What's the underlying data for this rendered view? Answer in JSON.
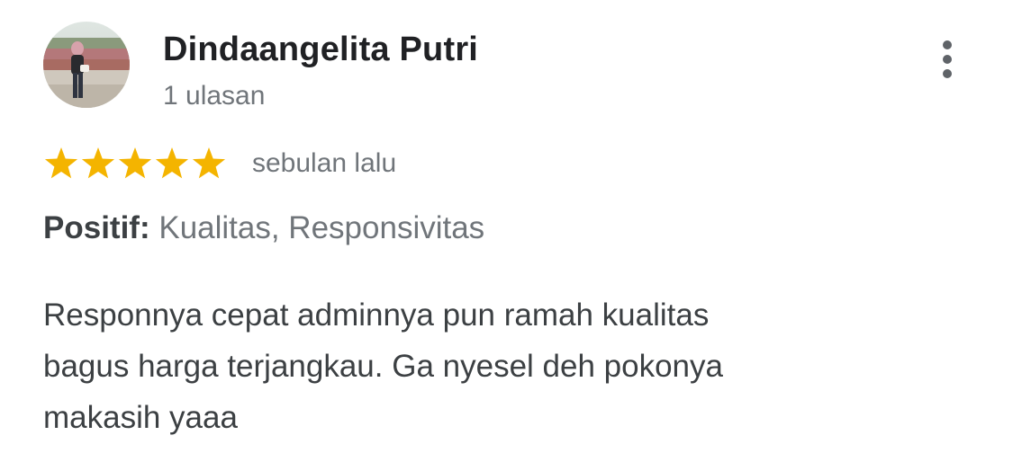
{
  "review": {
    "author": {
      "name": "Dindaangelita Putri",
      "review_count": "1 ulasan",
      "avatar": "profile-photo"
    },
    "menu_icon": "more-vertical-icon",
    "rating": {
      "stars": 5,
      "max_stars": 5,
      "star_color": "#f4b400"
    },
    "time": "sebulan lalu",
    "highlights": {
      "label": "Positif:",
      "values": "Kualitas, Responsivitas"
    },
    "text_lines": [
      "Responnya cepat adminnya pun ramah kualitas",
      "bagus harga terjangkau. Ga nyesel deh pokonya",
      "makasih yaaa"
    ]
  },
  "colors": {
    "primary_text": "#202124",
    "body_text": "#3c4043",
    "secondary_text": "#70757a",
    "star": "#f4b400"
  }
}
